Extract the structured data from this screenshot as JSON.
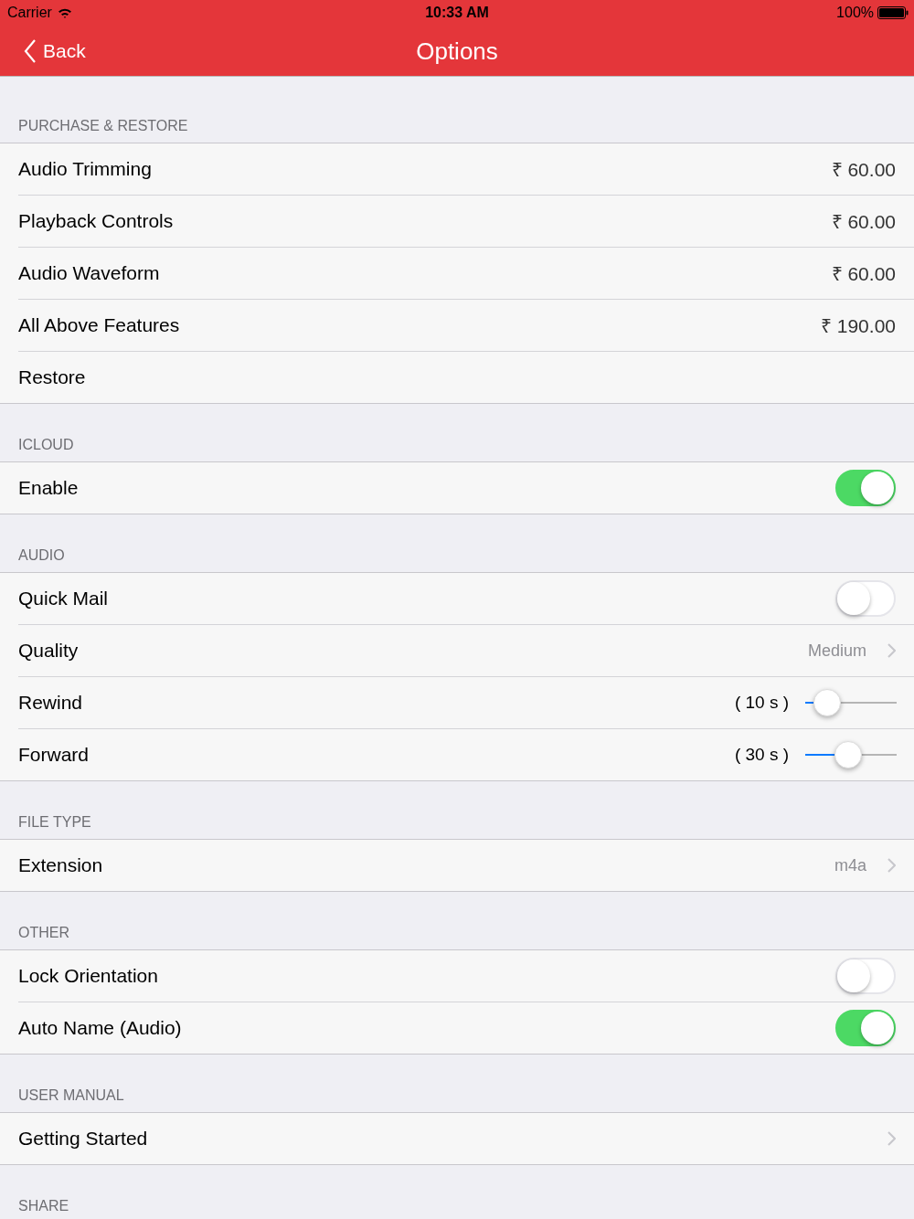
{
  "status_bar": {
    "carrier": "Carrier",
    "time": "10:33 AM",
    "battery": "100%"
  },
  "nav": {
    "back": "Back",
    "title": "Options"
  },
  "sections": [
    {
      "header": "PURCHASE & RESTORE",
      "rows": [
        {
          "kind": "value",
          "label": "Audio Trimming",
          "value": "₹ 60.00"
        },
        {
          "kind": "value",
          "label": "Playback Controls",
          "value": "₹ 60.00"
        },
        {
          "kind": "value",
          "label": "Audio Waveform",
          "value": "₹ 60.00"
        },
        {
          "kind": "value",
          "label": "All Above Features",
          "value": "₹ 190.00"
        },
        {
          "kind": "plain",
          "label": "Restore"
        }
      ]
    },
    {
      "header": "ICLOUD",
      "rows": [
        {
          "kind": "toggle",
          "label": "Enable",
          "on": true
        }
      ]
    },
    {
      "header": "AUDIO",
      "rows": [
        {
          "kind": "toggle",
          "label": "Quick Mail",
          "on": false
        },
        {
          "kind": "disclosure",
          "label": "Quality",
          "value": "Medium"
        },
        {
          "kind": "slider",
          "label": "Rewind",
          "reading": "( 10 s )",
          "level": 0.23
        },
        {
          "kind": "slider",
          "label": "Forward",
          "reading": "( 30 s )",
          "level": 0.46
        }
      ]
    },
    {
      "header": "FILE TYPE",
      "rows": [
        {
          "kind": "disclosure",
          "label": "Extension",
          "value": "m4a"
        }
      ]
    },
    {
      "header": "OTHER",
      "rows": [
        {
          "kind": "toggle",
          "label": "Lock Orientation",
          "on": false
        },
        {
          "kind": "toggle",
          "label": "Auto Name (Audio)",
          "on": true
        }
      ]
    },
    {
      "header": "USER MANUAL",
      "rows": [
        {
          "kind": "disclosure",
          "label": "Getting Started"
        }
      ]
    },
    {
      "header": "SHARE"
    }
  ]
}
